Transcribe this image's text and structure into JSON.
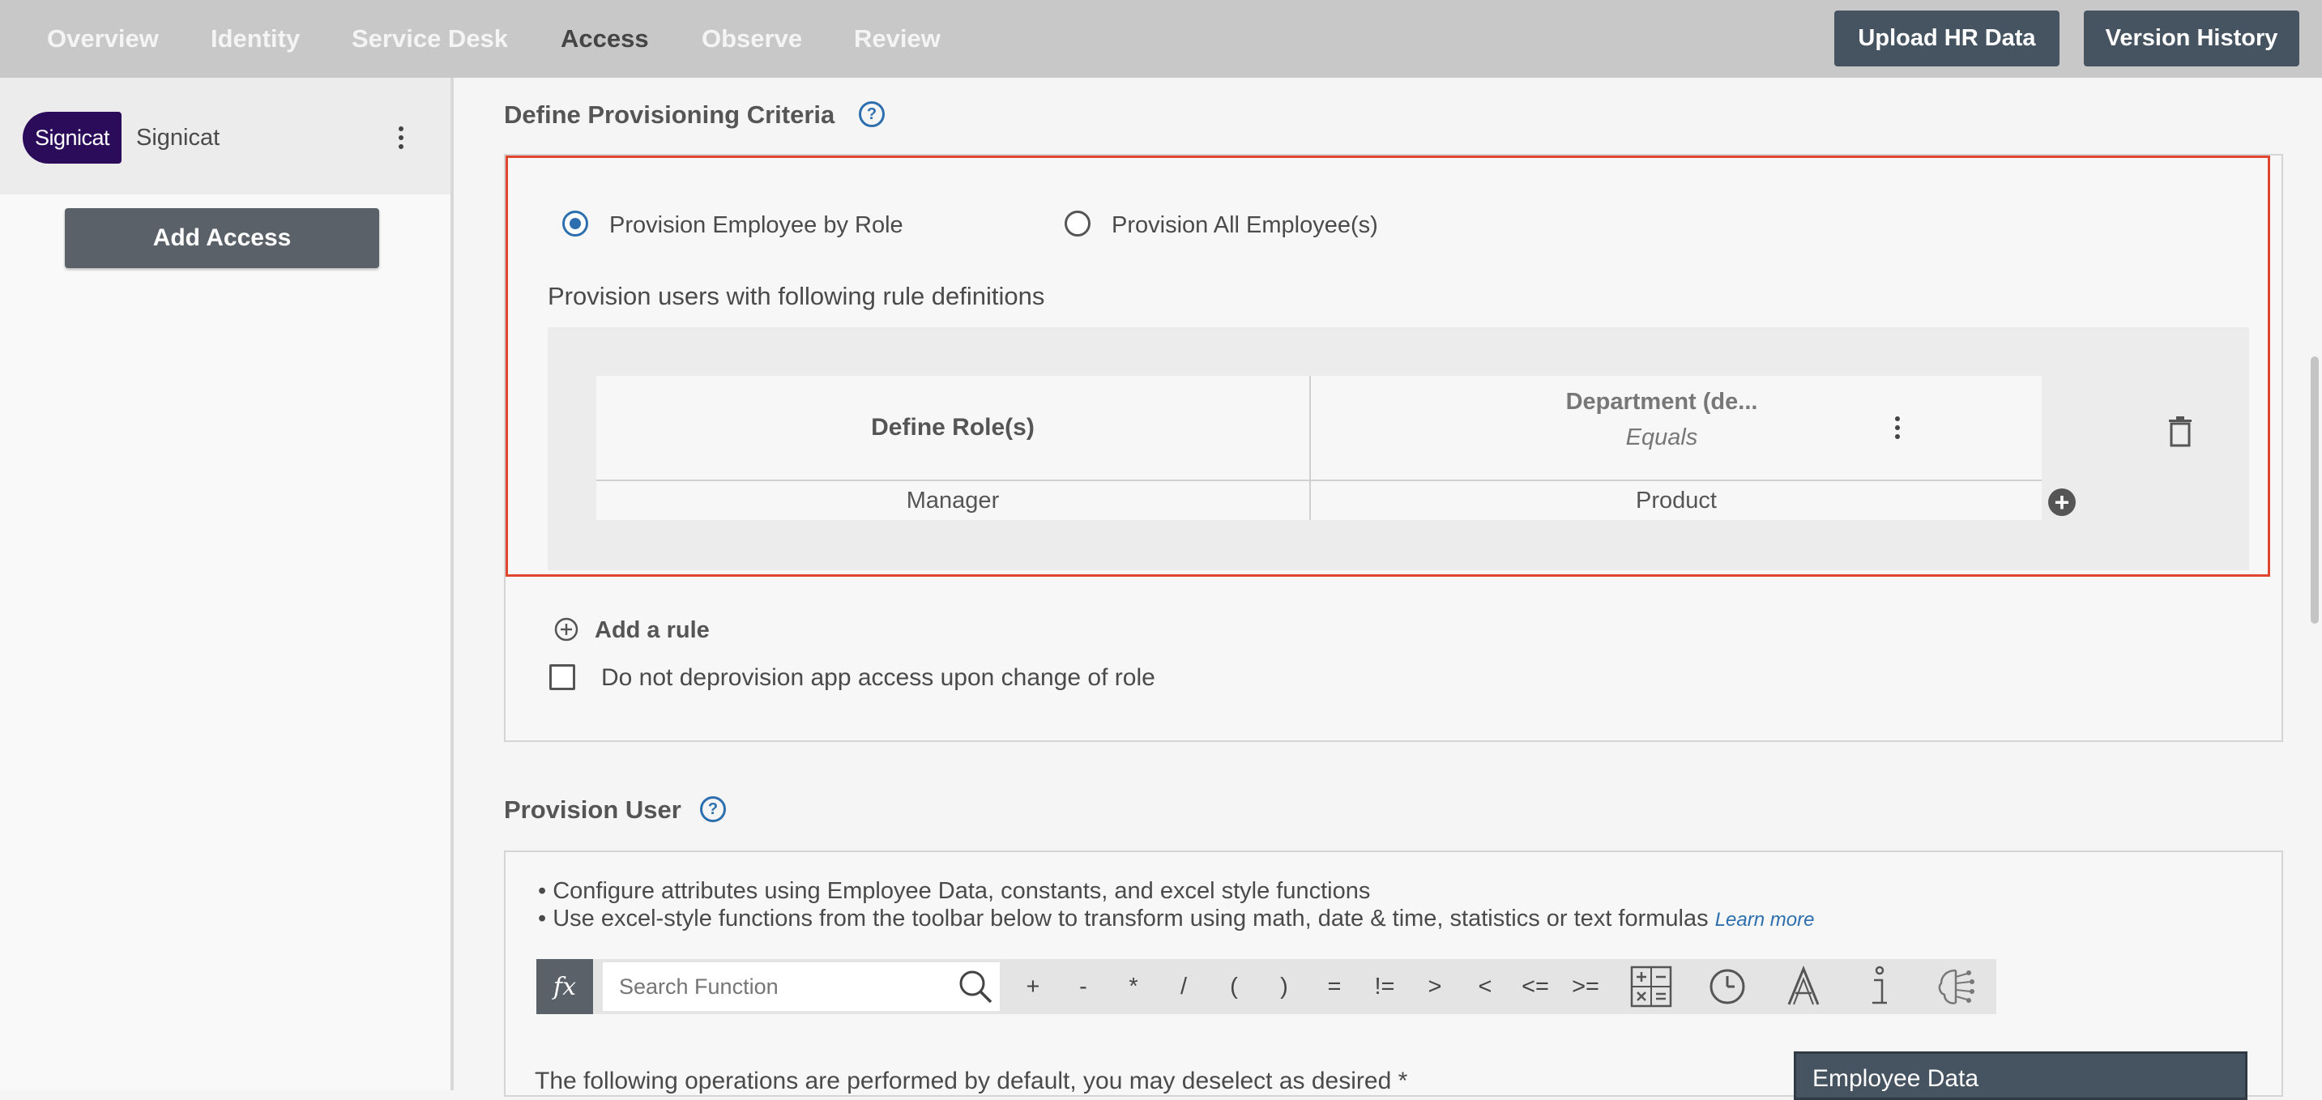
{
  "nav": {
    "tabs": [
      "Overview",
      "Identity",
      "Service Desk",
      "Access",
      "Observe",
      "Review"
    ],
    "active_tab": "Access",
    "upload_label": "Upload HR Data",
    "version_label": "Version History"
  },
  "sidebar": {
    "logo_text": "Signicat",
    "app_name": "Signicat",
    "add_access_label": "Add Access"
  },
  "criteria": {
    "title": "Define Provisioning Criteria",
    "help_glyph": "?",
    "radio_role_label": "Provision Employee by Role",
    "radio_all_label": "Provision All Employee(s)",
    "selected": "Provision Employee by Role",
    "rule_intro": "Provision users with following rule definitions",
    "table": {
      "role_header": "Define Role(s)",
      "attr_header": "Department (de...",
      "attr_operator": "Equals",
      "rows": [
        {
          "role": "Manager",
          "value": "Product"
        }
      ]
    },
    "add_rule_label": "Add a rule",
    "deprovision_label": "Do not deprovision app access upon change of role"
  },
  "provision_user": {
    "title": "Provision User",
    "help_glyph": "?",
    "bullets": [
      "Configure attributes using Employee Data, constants, and excel style functions",
      "Use excel-style functions from the toolbar below to transform using math, date & time, statistics or text formulas"
    ],
    "learn_more": "Learn more",
    "fx_label": "fx",
    "search_placeholder": "Search Function",
    "operators": [
      "+",
      "-",
      "*",
      "/",
      "(",
      ")",
      "=",
      "!=",
      ">",
      "<",
      "<=",
      ">="
    ],
    "toolbar_icons": [
      "calculator-icon",
      "clock-icon",
      "text-format-icon",
      "info-icon",
      "ai-brain-icon"
    ],
    "footer_text": "The following operations are performed by default, you may deselect as desired *",
    "employee_data_label": "Employee Data"
  },
  "colors": {
    "nav_bg": "#c8c8c8",
    "button_bg": "#465462",
    "accent_blue": "#2d6fae",
    "highlight_red": "#e0452f",
    "logo_purple": "#2a0c5a"
  }
}
